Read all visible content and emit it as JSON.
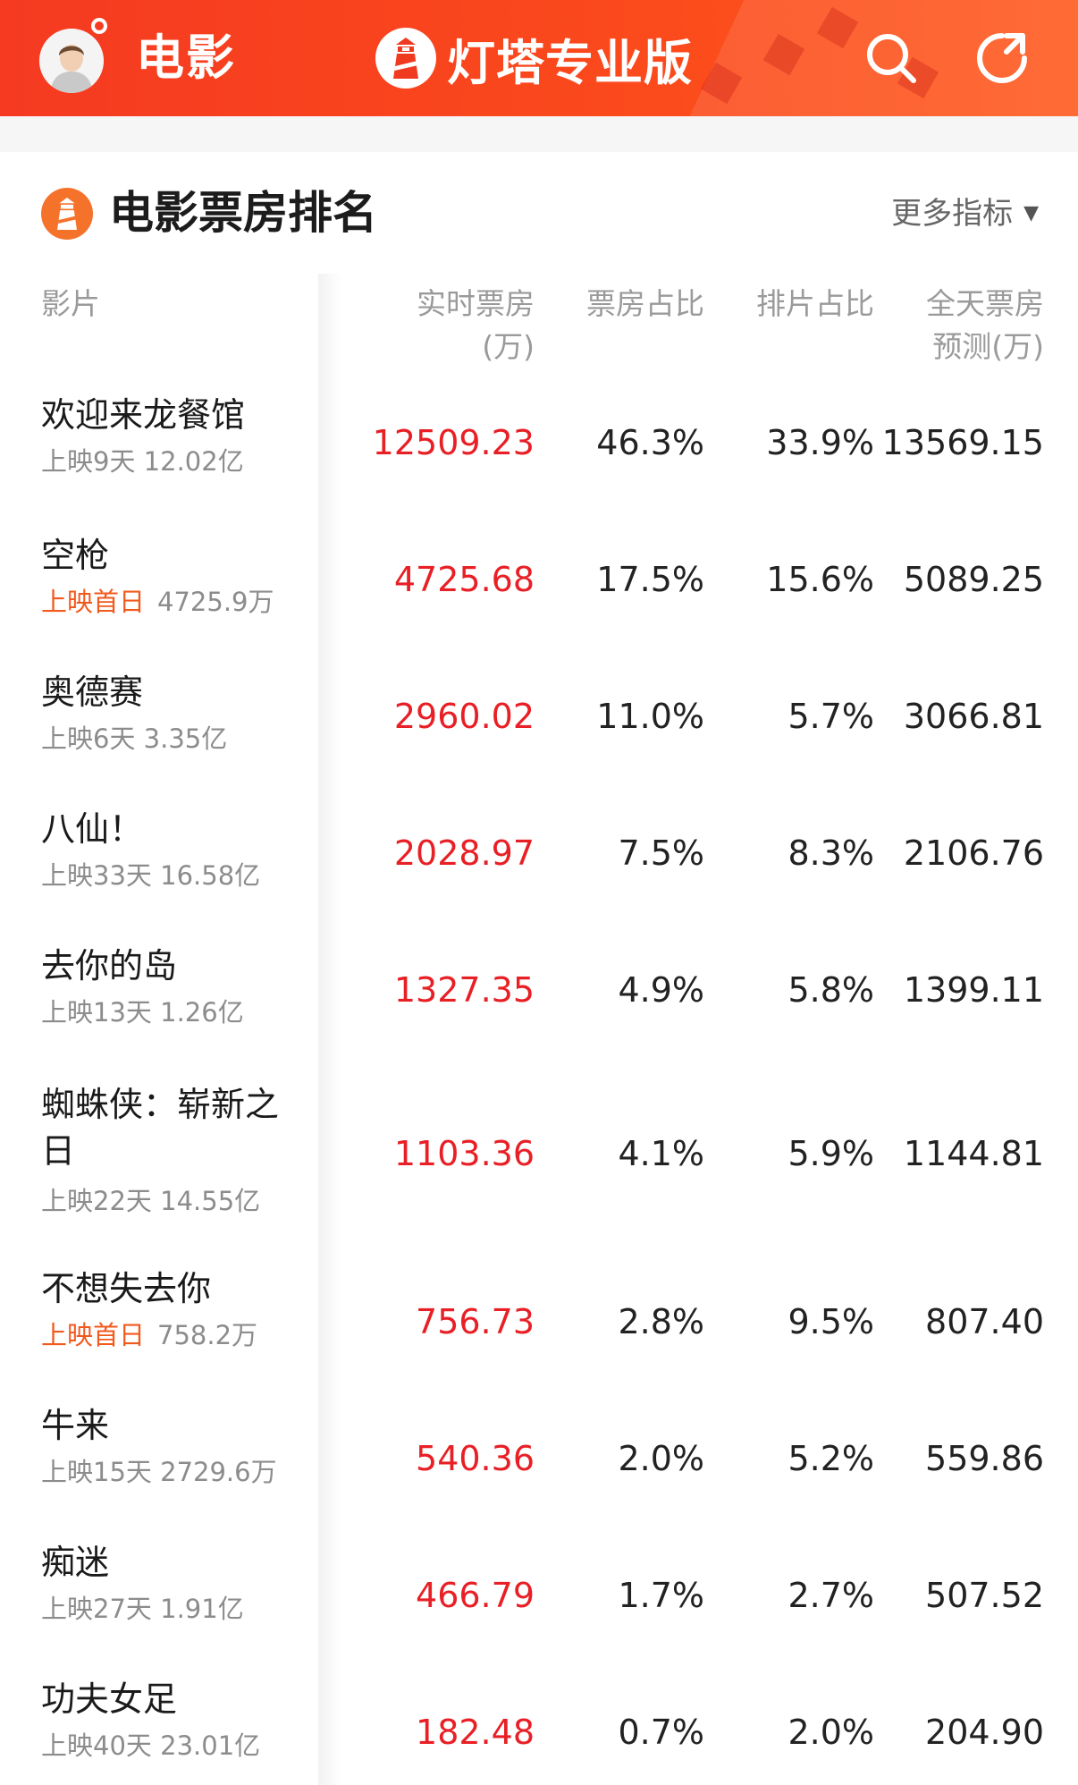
{
  "header": {
    "title": "电影",
    "brand": "灯塔专业版",
    "colors": {
      "gradient_start": "#f53a21",
      "gradient_end": "#ff5a1e"
    },
    "icons": [
      "user-avatar-icon",
      "lighthouse-logo-icon",
      "search-icon",
      "refresh-icon"
    ]
  },
  "section": {
    "title": "电影票房排名",
    "more_label": "更多指标",
    "more_caret": "▼"
  },
  "table": {
    "headers": {
      "film": "影片",
      "realtime_1": "实时票房",
      "realtime_2": "(万)",
      "share": "票房占比",
      "screen": "排片占比",
      "forecast_1": "全天票房",
      "forecast_2": "预测(万)"
    },
    "rows": [
      {
        "name": "欢迎来龙餐馆",
        "tag": "",
        "sub": "上映9天 12.02亿",
        "realtime": "12509.23",
        "share": "46.3%",
        "screen": "33.9%",
        "forecast": "13569.15"
      },
      {
        "name": "空枪",
        "tag": "上映首日",
        "sub": "4725.9万",
        "realtime": "4725.68",
        "share": "17.5%",
        "screen": "15.6%",
        "forecast": "5089.25"
      },
      {
        "name": "奥德赛",
        "tag": "",
        "sub": "上映6天 3.35亿",
        "realtime": "2960.02",
        "share": "11.0%",
        "screen": "5.7%",
        "forecast": "3066.81"
      },
      {
        "name": "八仙！",
        "tag": "",
        "sub": "上映33天 16.58亿",
        "realtime": "2028.97",
        "share": "7.5%",
        "screen": "8.3%",
        "forecast": "2106.76"
      },
      {
        "name": "去你的岛",
        "tag": "",
        "sub": "上映13天 1.26亿",
        "realtime": "1327.35",
        "share": "4.9%",
        "screen": "5.8%",
        "forecast": "1399.11"
      },
      {
        "name": "蜘蛛侠：崭新之日",
        "tag": "",
        "sub": "上映22天 14.55亿",
        "realtime": "1103.36",
        "share": "4.1%",
        "screen": "5.9%",
        "forecast": "1144.81"
      },
      {
        "name": "不想失去你",
        "tag": "上映首日",
        "sub": "758.2万",
        "realtime": "756.73",
        "share": "2.8%",
        "screen": "9.5%",
        "forecast": "807.40"
      },
      {
        "name": "牛来",
        "tag": "",
        "sub": "上映15天 2729.6万",
        "realtime": "540.36",
        "share": "2.0%",
        "screen": "5.2%",
        "forecast": "559.86"
      },
      {
        "name": "痴迷",
        "tag": "",
        "sub": "上映27天 1.91亿",
        "realtime": "466.79",
        "share": "1.7%",
        "screen": "2.7%",
        "forecast": "507.52"
      },
      {
        "name": "功夫女足",
        "tag": "",
        "sub": "上映40天 23.01亿",
        "realtime": "182.48",
        "share": "0.7%",
        "screen": "2.0%",
        "forecast": "204.90"
      }
    ]
  }
}
